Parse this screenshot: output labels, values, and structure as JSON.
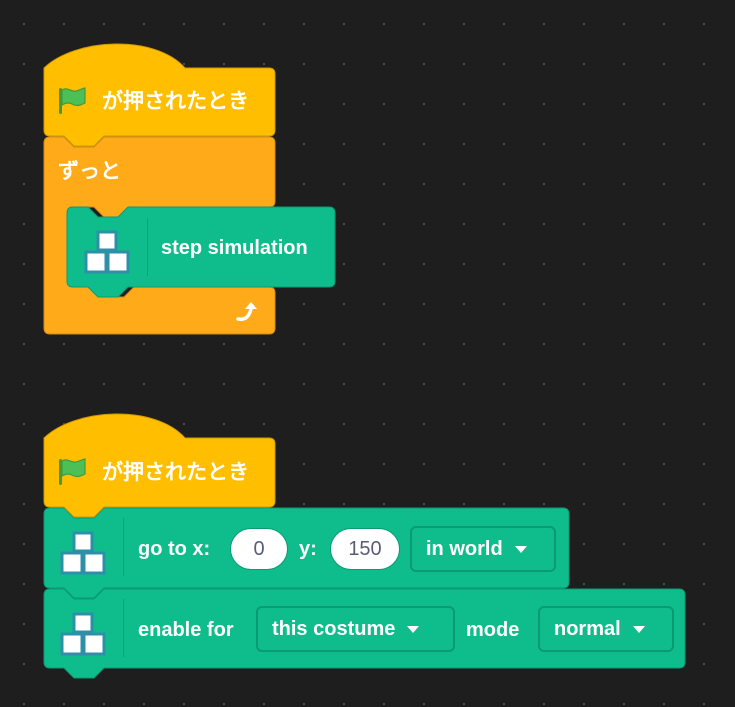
{
  "palette": {
    "events": "#ffbf00",
    "events_edge": "#cc9900",
    "control": "#ffab19",
    "control_edge": "#cf8b17",
    "extension": "#0fbd8c",
    "extension_edge": "#0b9a72",
    "flag_green": "#4cbf56"
  },
  "script1": {
    "hat_label": "が押されたとき",
    "hat_icon": "green-flag-icon",
    "forever_label": "ずっと",
    "forever_loop_icon": "loop-arrow-icon",
    "inner_block": {
      "label": "step simulation",
      "icon": "stacked-boxes-icon"
    }
  },
  "script2": {
    "hat_label": "が押されたとき",
    "hat_icon": "green-flag-icon",
    "goto_block": {
      "icon": "stacked-boxes-icon",
      "label_x": "go to x:",
      "x_value": "0",
      "label_y": "y:",
      "y_value": "150",
      "space_dropdown": "in world"
    },
    "enable_block": {
      "icon": "stacked-boxes-icon",
      "label_for": "enable for",
      "target_dropdown": "this costume",
      "label_mode": "mode",
      "mode_dropdown": "normal"
    }
  }
}
